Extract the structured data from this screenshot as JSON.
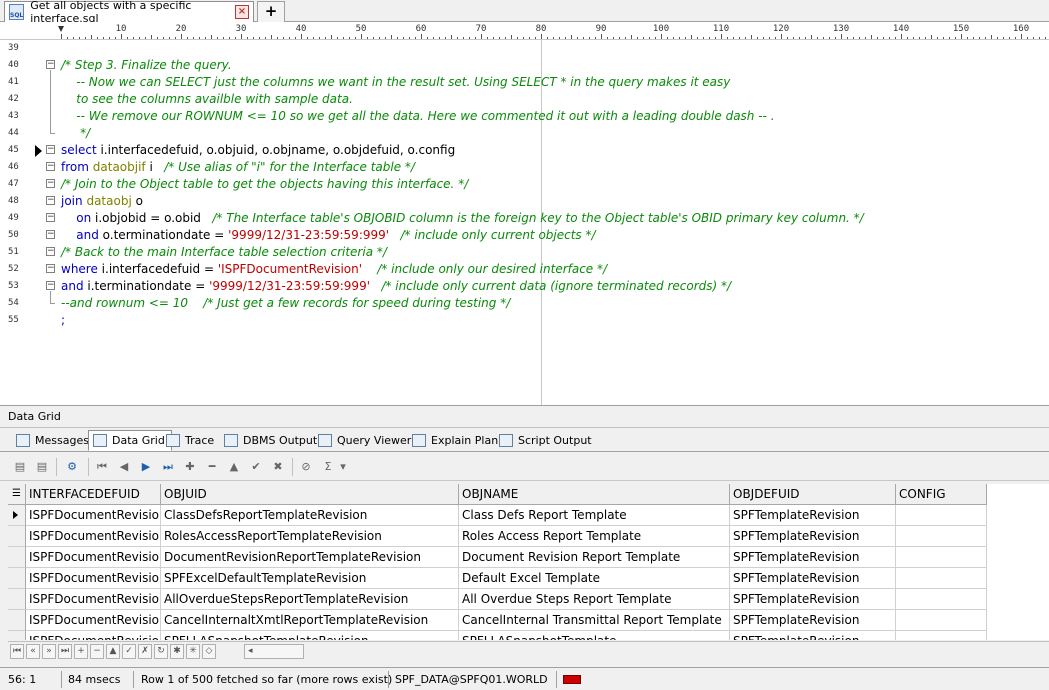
{
  "tab": {
    "title": "Get all objects with a specific interface.sql",
    "add_label": "+"
  },
  "ruler": {
    "labels": [
      "10",
      "20",
      "30",
      "40",
      "50",
      "60",
      "70",
      "80",
      "90",
      "100",
      "110",
      "120",
      "130",
      "140",
      "150",
      "160"
    ]
  },
  "editor": {
    "lines": [
      {
        "num": "39",
        "tokens": []
      },
      {
        "num": "40",
        "tokens": [
          {
            "t": "cm",
            "v": "/* Step 3. Finalize the query."
          }
        ]
      },
      {
        "num": "41",
        "tokens": [
          {
            "t": "cm",
            "v": "    -- Now we can SELECT just the columns we want in the result set. Using SELECT * in the query makes it easy"
          }
        ]
      },
      {
        "num": "42",
        "tokens": [
          {
            "t": "cm",
            "v": "    to see the columns availble with sample data."
          }
        ]
      },
      {
        "num": "43",
        "tokens": [
          {
            "t": "cm",
            "v": "    -- We remove our ROWNUM <= 10 so we get all the data. Here we commented it out with a leading double dash -- ."
          }
        ]
      },
      {
        "num": "44",
        "tokens": [
          {
            "t": "cm",
            "v": "     */"
          }
        ]
      },
      {
        "num": "45",
        "tokens": [
          {
            "t": "kw",
            "v": "select"
          },
          {
            "t": "txt",
            "v": " i.interfacedefuid, o.objuid, o.objname, o.objdefuid, o.config"
          }
        ]
      },
      {
        "num": "46",
        "tokens": [
          {
            "t": "kw",
            "v": "from"
          },
          {
            "t": "txt",
            "v": " "
          },
          {
            "t": "tbl",
            "v": "dataobjif"
          },
          {
            "t": "txt",
            "v": " i   "
          },
          {
            "t": "cm",
            "v": "/* Use alias of \"i\" for the Interface table */"
          }
        ]
      },
      {
        "num": "47",
        "tokens": [
          {
            "t": "cm",
            "v": "/* Join to the Object table to get the objects having this interface. */"
          }
        ]
      },
      {
        "num": "48",
        "tokens": [
          {
            "t": "kw",
            "v": "join"
          },
          {
            "t": "txt",
            "v": " "
          },
          {
            "t": "tbl",
            "v": "dataobj"
          },
          {
            "t": "txt",
            "v": " o"
          }
        ]
      },
      {
        "num": "49",
        "tokens": [
          {
            "t": "txt",
            "v": "    "
          },
          {
            "t": "kw",
            "v": "on"
          },
          {
            "t": "txt",
            "v": " i.objobid = o.obid   "
          },
          {
            "t": "cm",
            "v": "/* The Interface table's OBJOBID column is the foreign key to the Object table's OBID primary key column. */"
          }
        ]
      },
      {
        "num": "50",
        "tokens": [
          {
            "t": "txt",
            "v": "    "
          },
          {
            "t": "kw",
            "v": "and"
          },
          {
            "t": "txt",
            "v": " o.terminationdate = "
          },
          {
            "t": "str",
            "v": "'9999/12/31-23:59:59:999'"
          },
          {
            "t": "txt",
            "v": "   "
          },
          {
            "t": "cm",
            "v": "/* include only current objects */"
          }
        ]
      },
      {
        "num": "51",
        "tokens": [
          {
            "t": "cm",
            "v": "/* Back to the main Interface table selection criteria */"
          }
        ]
      },
      {
        "num": "52",
        "tokens": [
          {
            "t": "kw",
            "v": "where"
          },
          {
            "t": "txt",
            "v": " i.interfacedefuid = "
          },
          {
            "t": "str",
            "v": "'ISPFDocumentRevision'"
          },
          {
            "t": "txt",
            "v": "    "
          },
          {
            "t": "cm",
            "v": "/* include only our desired interface */"
          }
        ]
      },
      {
        "num": "53",
        "tokens": [
          {
            "t": "kw",
            "v": "and"
          },
          {
            "t": "txt",
            "v": " i.terminationdate = "
          },
          {
            "t": "str",
            "v": "'9999/12/31-23:59:59:999'"
          },
          {
            "t": "txt",
            "v": "   "
          },
          {
            "t": "cm",
            "v": "/* include only current data (ignore terminated records) */"
          }
        ]
      },
      {
        "num": "54",
        "tokens": [
          {
            "t": "cm",
            "v": "--and rownum <= 10    /* Just get a few records for speed during testing */"
          }
        ]
      },
      {
        "num": "55",
        "tokens": [
          {
            "t": "kw",
            "v": ";"
          }
        ]
      }
    ]
  },
  "panel": {
    "title": "Data Grid"
  },
  "output_tabs": [
    {
      "label": "Messages",
      "icon": "messages-icon"
    },
    {
      "label": "Data Grid",
      "icon": "data-grid-icon"
    },
    {
      "label": "Trace",
      "icon": "trace-icon"
    },
    {
      "label": "DBMS Output",
      "icon": "dbms-output-icon"
    },
    {
      "label": "Query Viewer",
      "icon": "query-viewer-icon"
    },
    {
      "label": "Explain Plan",
      "icon": "explain-plan-icon"
    },
    {
      "label": "Script Output",
      "icon": "script-output-icon"
    }
  ],
  "grid": {
    "columns": [
      "INTERFACEDEFUID",
      "OBJUID",
      "OBJNAME",
      "OBJDEFUID",
      "CONFIG"
    ],
    "rows": [
      [
        "ISPFDocumentRevision",
        "ClassDefsReportTemplateRevision",
        "Class Defs Report Template",
        "SPFTemplateRevision",
        ""
      ],
      [
        "ISPFDocumentRevision",
        "RolesAccessReportTemplateRevision",
        "Roles Access Report Template",
        "SPFTemplateRevision",
        ""
      ],
      [
        "ISPFDocumentRevision",
        "DocumentRevisionReportTemplateRevision",
        "Document Revision Report Template",
        "SPFTemplateRevision",
        ""
      ],
      [
        "ISPFDocumentRevision",
        "SPFExcelDefaultTemplateRevision",
        "Default Excel Template",
        "SPFTemplateRevision",
        ""
      ],
      [
        "ISPFDocumentRevision",
        "AllOverdueStepsReportTemplateRevision",
        "All Overdue Steps Report Template",
        "SPFTemplateRevision",
        ""
      ],
      [
        "ISPFDocumentRevision",
        "CancelInternaltXmtlReportTemplateRevision",
        "CancelInternal Transmittal Report Template",
        "SPFTemplateRevision",
        ""
      ],
      [
        "ISPFDocumentRevision",
        "SPFLLASnapshotTemplateRevision",
        "SPFLLASnapshotTemplate",
        "SPFTemplateRevision",
        ""
      ]
    ]
  },
  "status": {
    "position": "56:   1",
    "time": "84 msecs",
    "rows": "Row 1 of 500 fetched so far (more rows exist)",
    "connection": "SPF_DATA@SPFQ01.WORLD"
  }
}
